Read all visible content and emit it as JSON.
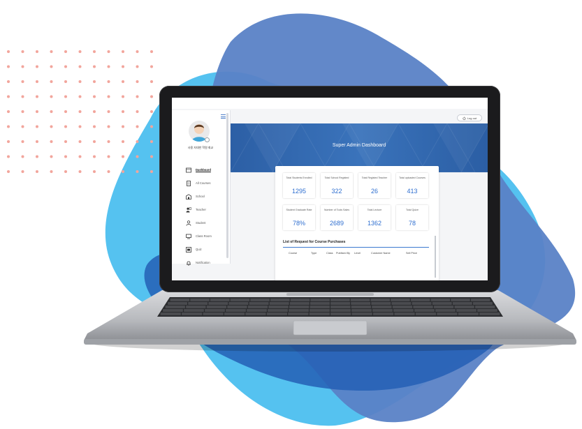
{
  "colors": {
    "blob_dark": "#5a82c6",
    "blob_light": "#55c2f0",
    "blob_deep": "#245fb5",
    "dot_pink": "#f2a59c",
    "accent": "#2f6fd0"
  },
  "header": {
    "logout_label": "Log out",
    "logout_icon": "power-icon"
  },
  "hero": {
    "title": "Super Admin Dashboard"
  },
  "user": {
    "name": "사용 자대한 학원 회교"
  },
  "sidebar": {
    "items": [
      {
        "label": "Dashboard",
        "icon": "dashboard-icon",
        "active": true
      },
      {
        "label": "All Courses",
        "icon": "document-icon",
        "active": false
      },
      {
        "label": "School",
        "icon": "school-icon",
        "active": false
      },
      {
        "label": "Teacher",
        "icon": "teacher-icon",
        "active": false
      },
      {
        "label": "Student",
        "icon": "student-icon",
        "active": false
      },
      {
        "label": "Class Room",
        "icon": "monitor-icon",
        "active": false
      },
      {
        "label": "Quiz",
        "icon": "quiz-icon",
        "active": false
      },
      {
        "label": "Notification",
        "icon": "bell-icon",
        "active": false
      }
    ]
  },
  "stats": [
    {
      "label": "Total Students Enrolled",
      "value": "1295"
    },
    {
      "label": "Total School Registed",
      "value": "322"
    },
    {
      "label": "Total Registed Teacher",
      "value": "26"
    },
    {
      "label": "Total uploaded Courses",
      "value": "413"
    },
    {
      "label": "Student Graduate Rate",
      "value": "78%"
    },
    {
      "label": "Number of Tools Sales",
      "value": "2689"
    },
    {
      "label": "Total Lecture",
      "value": "1362"
    },
    {
      "label": "Total Quize",
      "value": "78"
    }
  ],
  "purchases": {
    "title": "List of Request for Course Purchases",
    "columns": [
      "Course",
      "Type",
      "Class",
      "Publised By",
      "Level",
      "Customer Name",
      "Sell Price"
    ]
  }
}
